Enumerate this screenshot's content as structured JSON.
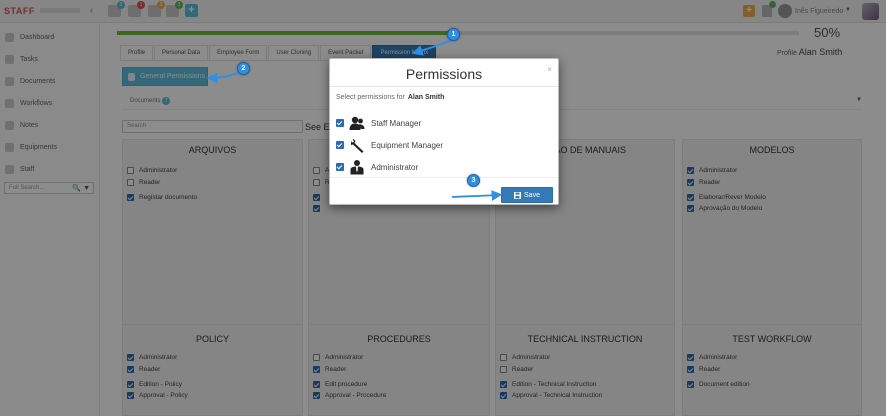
{
  "app": {
    "logo_text": "STAFF",
    "user_name": "Inês Figueiredo"
  },
  "topbar": {
    "badges": [
      "2",
      "1",
      "3",
      "3"
    ],
    "plus_label": "+"
  },
  "sidebar": {
    "items": [
      {
        "label": "Dashboard",
        "icon": "dashboard-icon"
      },
      {
        "label": "Tasks",
        "icon": "tasks-icon"
      },
      {
        "label": "Documents",
        "icon": "documents-icon"
      },
      {
        "label": "Workflows",
        "icon": "workflows-icon"
      },
      {
        "label": "Notes",
        "icon": "notes-icon"
      },
      {
        "label": "Equipments",
        "icon": "equipments-icon"
      },
      {
        "label": "Staff",
        "icon": "staff-icon"
      }
    ],
    "search_placeholder": "Full Search..."
  },
  "profile": {
    "progress_percent": 50,
    "progress_label": "50%",
    "label": "Profile",
    "name": "Alan Smith"
  },
  "tabs": [
    {
      "label": "Profile",
      "active": false
    },
    {
      "label": "Personal Data",
      "active": false
    },
    {
      "label": "Employee Form",
      "active": false
    },
    {
      "label": "User Cloning",
      "active": false
    },
    {
      "label": "Event Packet",
      "active": false
    },
    {
      "label": "Permission Matrix",
      "active": true
    }
  ],
  "general_permissions_label": "General Permissions",
  "documents_label": "Documents",
  "documents_badge": "?",
  "search_placeholder": "Search",
  "see_every_label": "See Ev",
  "cards": {
    "arquivos": {
      "title": "ARQUIVOS",
      "rows": [
        {
          "label": "Administrator",
          "checked": false
        },
        {
          "label": "Reader",
          "checked": false
        },
        {
          "label": "Registar documento",
          "checked": true
        }
      ]
    },
    "card2": {
      "rows": [
        {
          "label": "A",
          "checked": false
        },
        {
          "label": "R",
          "checked": false
        },
        {
          "label": "",
          "checked": true
        },
        {
          "label": "",
          "checked": true
        }
      ]
    },
    "manuais": {
      "title": "ÇÃO DE MANUAIS"
    },
    "modelos": {
      "title": "MODELOS",
      "rows": [
        {
          "label": "Administrator",
          "checked": true
        },
        {
          "label": "Reader",
          "checked": true
        },
        {
          "label": "Elaborar/Rever Modelo",
          "checked": true
        },
        {
          "label": "Aprovação do Modelo",
          "checked": true
        }
      ]
    },
    "policy": {
      "title": "POLICY",
      "rows": [
        {
          "label": "Administrator",
          "checked": true
        },
        {
          "label": "Reader",
          "checked": true
        },
        {
          "label": "Edition - Policy",
          "checked": true
        },
        {
          "label": "Approval - Policy",
          "checked": true
        }
      ]
    },
    "procedures": {
      "title": "PROCEDURES",
      "rows": [
        {
          "label": "Administrator",
          "checked": false
        },
        {
          "label": "Reader",
          "checked": true
        },
        {
          "label": "Edit procedure",
          "checked": true
        },
        {
          "label": "Approval - Procedure",
          "checked": true
        }
      ]
    },
    "technical": {
      "title": "TECHNICAL INSTRUCTION",
      "rows": [
        {
          "label": "Administrator",
          "checked": false
        },
        {
          "label": "Reader",
          "checked": false
        },
        {
          "label": "Edition - Technical Instruction",
          "checked": true
        },
        {
          "label": "Approval - Technical Instruction",
          "checked": true
        }
      ]
    },
    "test_workflow": {
      "title": "TEST WORKFLOW",
      "rows": [
        {
          "label": "Administrator",
          "checked": true
        },
        {
          "label": "Reader",
          "checked": true
        },
        {
          "label": "Document edition",
          "checked": true
        }
      ]
    }
  },
  "modal": {
    "title": "Permissions",
    "close": "×",
    "subtitle": "Select permissions for",
    "subject": "Alan Smith",
    "options": [
      {
        "label": "Staff Manager",
        "icon": "staff-manager-icon",
        "checked": true
      },
      {
        "label": "Equipment Manager",
        "icon": "wrench-icon",
        "checked": true
      },
      {
        "label": "Administrator",
        "icon": "administrator-icon",
        "checked": true
      }
    ],
    "save_label": "Save"
  },
  "annotations": {
    "steps": [
      "1",
      "2",
      "3"
    ]
  },
  "colors": {
    "primary": "#337ab7",
    "info": "#5bc0de",
    "progress": "#6fba3c",
    "step": "#2f8ee5"
  }
}
